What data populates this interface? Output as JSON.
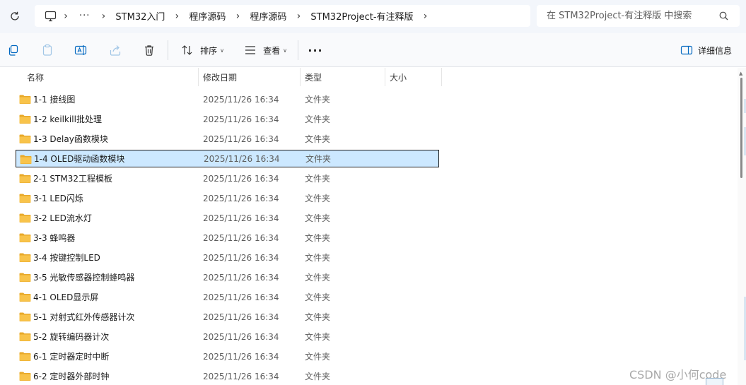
{
  "address": {
    "breadcrumbs": [
      "STM32入门",
      "程序源码",
      "程序源码",
      "STM32Project-有注释版"
    ],
    "more_label": "···",
    "icon": "this-pc-icon"
  },
  "search": {
    "placeholder": "在 STM32Project-有注释版 中搜索"
  },
  "toolbar": {
    "sort_label": "排序",
    "view_label": "查看",
    "more_label": "···",
    "details_label": "详细信息"
  },
  "columns": {
    "name": "名称",
    "date": "修改日期",
    "type": "类型",
    "size": "大小"
  },
  "files": [
    {
      "name": "1-1 接线图",
      "date": "2025/11/26 16:34",
      "type": "文件夹"
    },
    {
      "name": "1-2 keilkill批处理",
      "date": "2025/11/26 16:34",
      "type": "文件夹"
    },
    {
      "name": "1-3 Delay函数模块",
      "date": "2025/11/26 16:34",
      "type": "文件夹"
    },
    {
      "name": "1-4 OLED驱动函数模块",
      "date": "2025/11/26 16:34",
      "type": "文件夹",
      "selected": true
    },
    {
      "name": "2-1 STM32工程模板",
      "date": "2025/11/26 16:34",
      "type": "文件夹"
    },
    {
      "name": "3-1 LED闪烁",
      "date": "2025/11/26 16:34",
      "type": "文件夹"
    },
    {
      "name": "3-2 LED流水灯",
      "date": "2025/11/26 16:34",
      "type": "文件夹"
    },
    {
      "name": "3-3 蜂鸣器",
      "date": "2025/11/26 16:34",
      "type": "文件夹"
    },
    {
      "name": "3-4 按键控制LED",
      "date": "2025/11/26 16:34",
      "type": "文件夹"
    },
    {
      "name": "3-5 光敏传感器控制蜂鸣器",
      "date": "2025/11/26 16:34",
      "type": "文件夹"
    },
    {
      "name": "4-1 OLED显示屏",
      "date": "2025/11/26 16:34",
      "type": "文件夹"
    },
    {
      "name": "5-1 对射式红外传感器计次",
      "date": "2025/11/26 16:34",
      "type": "文件夹"
    },
    {
      "name": "5-2 旋转编码器计次",
      "date": "2025/11/26 16:34",
      "type": "文件夹"
    },
    {
      "name": "6-1 定时器定时中断",
      "date": "2025/11/26 16:34",
      "type": "文件夹"
    },
    {
      "name": "6-2 定时器外部时钟",
      "date": "2025/11/26 16:34",
      "type": "文件夹"
    }
  ],
  "watermark": "CSDN @小何code",
  "colors": {
    "folder": "#f8c34a",
    "selection": "#cce8ff",
    "accent": "#0067c0"
  }
}
